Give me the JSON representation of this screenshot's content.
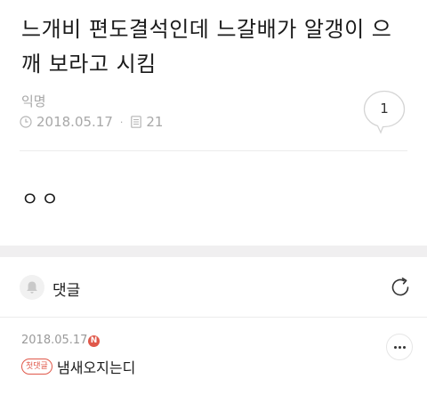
{
  "post": {
    "title": "느개비 편도결석인데 느갈배가 알갱이 으깨 보라고 시킴",
    "author": "익명",
    "date": "2018.05.17",
    "separator": "·",
    "views": "21",
    "comment_count": "1",
    "body": "ㅇㅇ"
  },
  "comments_section": {
    "title": "댓글"
  },
  "comments": [
    {
      "date": "2018.05.17",
      "new_badge": "N",
      "first_badge": "첫댓글",
      "text": "냄새오지는디"
    }
  ],
  "colors": {
    "meta_gray": "#a8a8a8",
    "accent_red": "#e0584a",
    "divider_band": "#f0eff0"
  },
  "icons": {
    "date": "clock-icon",
    "views": "document-icon",
    "comment_count": "speech-bubble-icon",
    "notify": "bell-icon",
    "refresh": "refresh-icon",
    "more": "more-dots-icon"
  }
}
